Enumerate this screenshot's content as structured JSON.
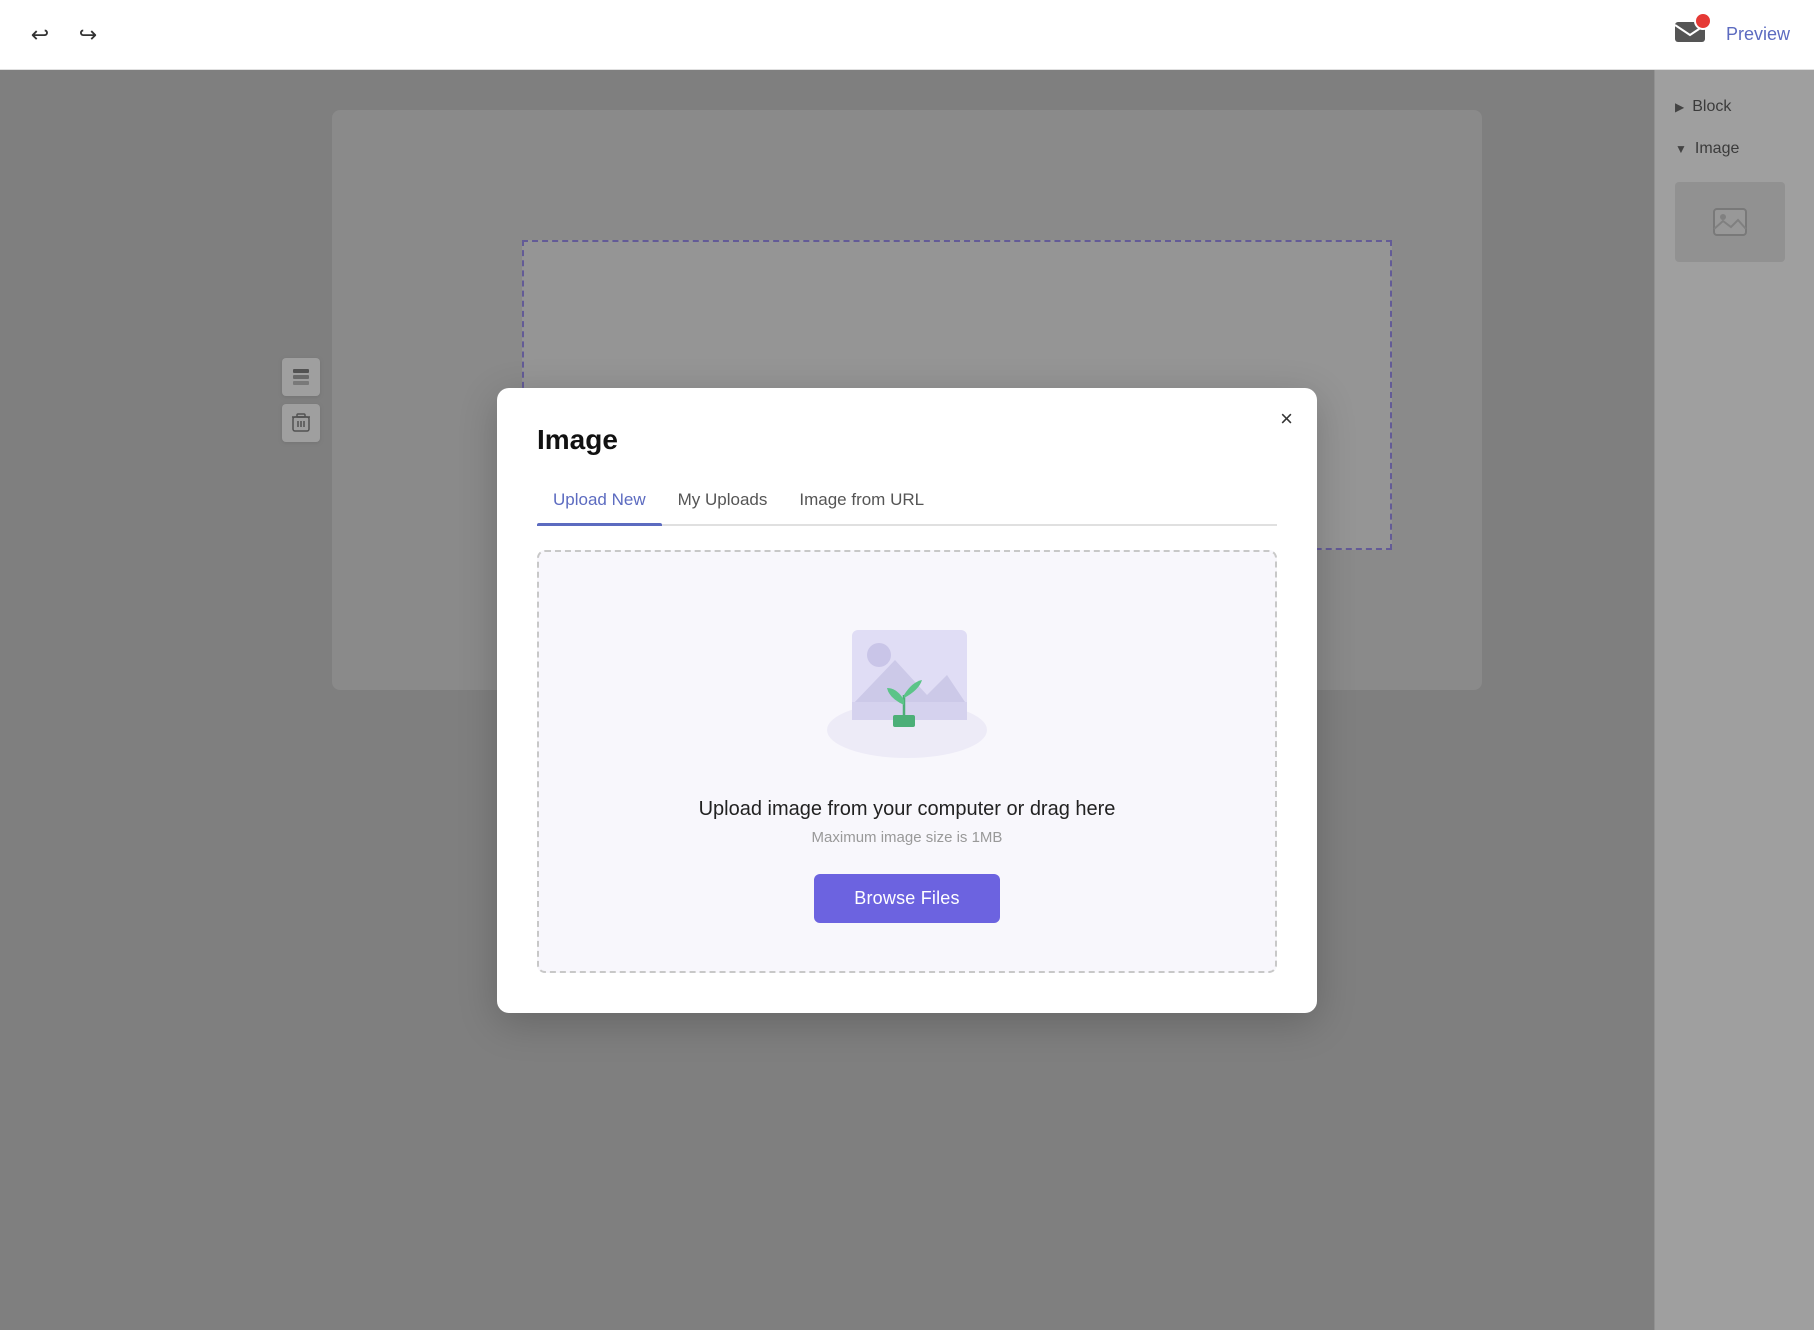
{
  "toolbar": {
    "undo_icon": "↩",
    "redo_icon": "↪",
    "preview_label": "Preview"
  },
  "right_panel": {
    "block_label": "Block",
    "image_label": "Image",
    "block_arrow": "▶",
    "image_arrow": "▼"
  },
  "modal": {
    "title": "Image",
    "close_icon": "×",
    "tabs": [
      {
        "id": "upload-new",
        "label": "Upload New",
        "active": true
      },
      {
        "id": "my-uploads",
        "label": "My Uploads",
        "active": false
      },
      {
        "id": "image-from-url",
        "label": "Image from URL",
        "active": false
      }
    ],
    "upload_area": {
      "main_text": "Upload image from your computer or drag here",
      "sub_text": "Maximum image size is 1MB",
      "browse_label": "Browse Files"
    }
  }
}
